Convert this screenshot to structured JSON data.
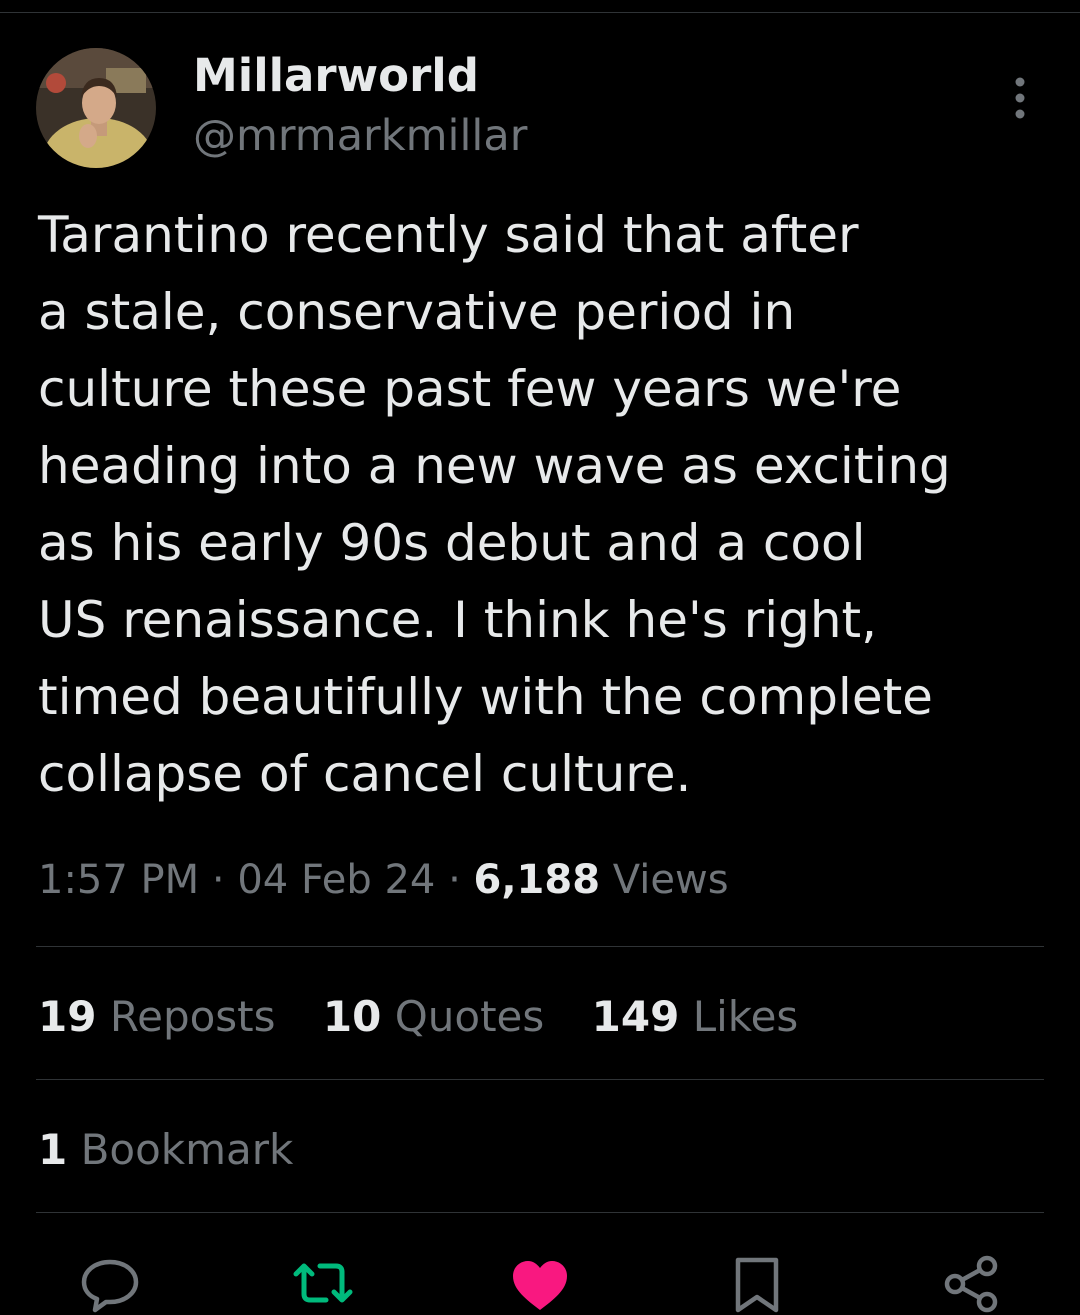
{
  "tweet": {
    "author": {
      "display_name": "Millarworld",
      "handle": "@mrmarkmillar"
    },
    "text": "Tarantino recently said that after\na stale, conservative period in\nculture these past few years we're\nheading into a new wave as exciting\nas his early 90s debut and a cool\nUS renaissance. I think he's right,\ntimed beautifully with the complete\ncollapse of cancel culture.",
    "time": "1:57 PM",
    "separator": "·",
    "date": "04 Feb 24",
    "views_count": "6,188",
    "views_label": "Views"
  },
  "stats": {
    "reposts_count": "19",
    "reposts_label": "Reposts",
    "quotes_count": "10",
    "quotes_label": "Quotes",
    "likes_count": "149",
    "likes_label": "Likes",
    "bookmarks_count": "1",
    "bookmarks_label": "Bookmark"
  },
  "actions": {
    "reply_icon": "speech-bubble-icon",
    "repost_icon": "repost-arrows-icon",
    "like_icon": "heart-icon",
    "bookmark_icon": "bookmark-icon",
    "share_icon": "share-nodes-icon",
    "more_icon": "vertical-ellipsis-icon",
    "repost_color": "#00ba7c",
    "like_color": "#f91880"
  },
  "theme": {
    "background": "#000000",
    "primary_text": "#e7e9ea",
    "secondary_text": "#71767b",
    "divider": "#2f3336"
  }
}
